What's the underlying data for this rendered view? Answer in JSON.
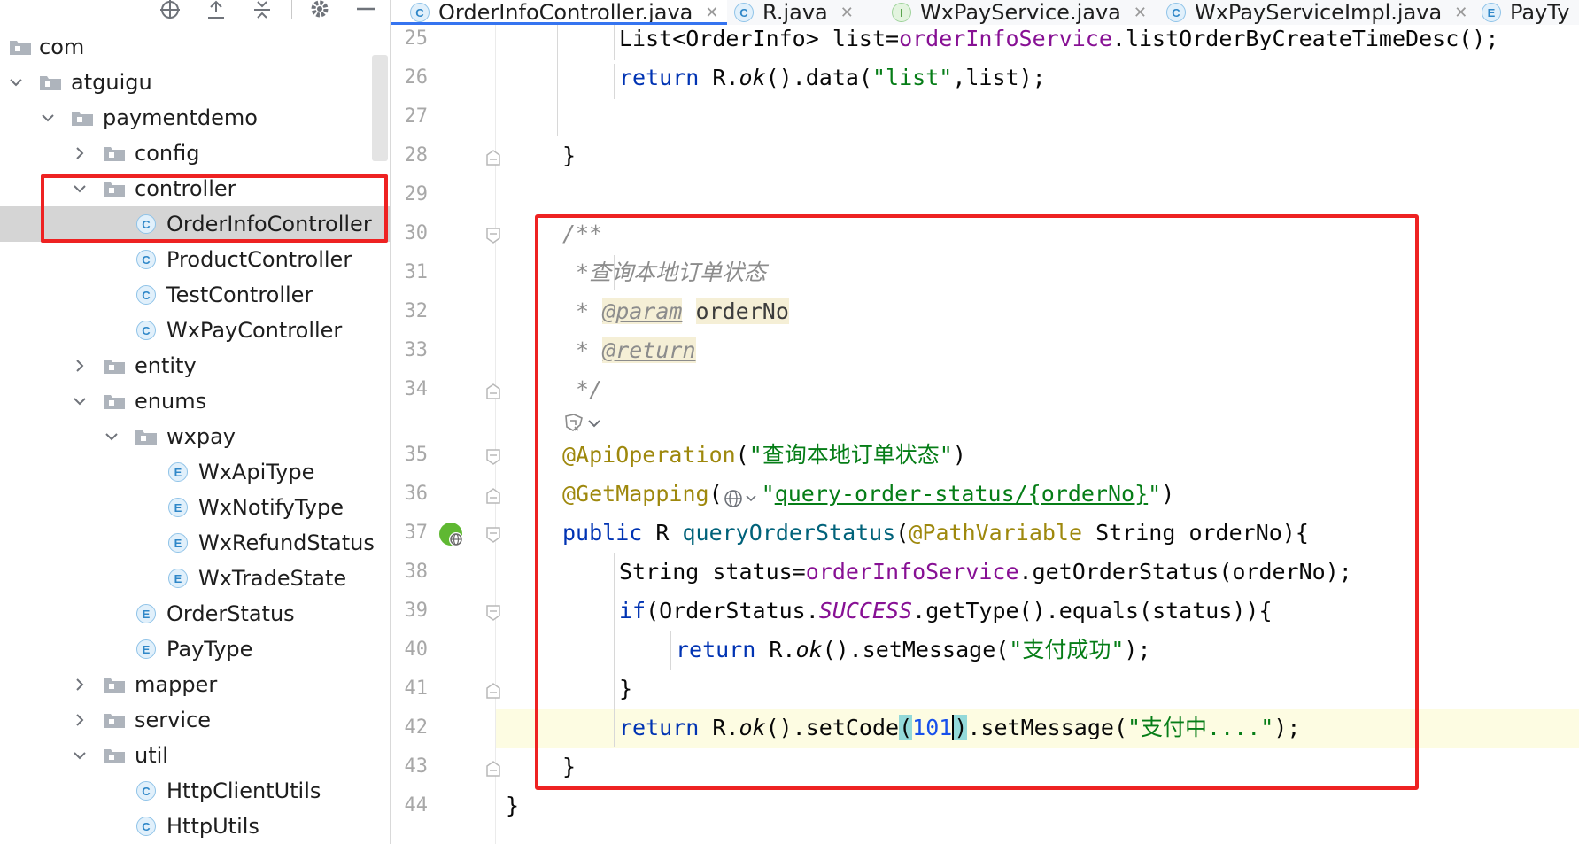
{
  "project_tree": {
    "items": [
      {
        "label": "com",
        "kind": "package",
        "expanded": null,
        "depth": 0
      },
      {
        "label": "atguigu",
        "kind": "package",
        "expanded": true,
        "depth": 0
      },
      {
        "label": "paymentdemo",
        "kind": "package",
        "expanded": true,
        "depth": 1
      },
      {
        "label": "config",
        "kind": "package",
        "expanded": false,
        "depth": 2
      },
      {
        "label": "controller",
        "kind": "package",
        "expanded": true,
        "depth": 2
      },
      {
        "label": "OrderInfoController",
        "kind": "class",
        "badge": "C",
        "depth": 3,
        "selected": true
      },
      {
        "label": "ProductController",
        "kind": "class",
        "badge": "C",
        "depth": 3
      },
      {
        "label": "TestController",
        "kind": "class",
        "badge": "C",
        "depth": 3
      },
      {
        "label": "WxPayController",
        "kind": "class",
        "badge": "C",
        "depth": 3
      },
      {
        "label": "entity",
        "kind": "package",
        "expanded": false,
        "depth": 2
      },
      {
        "label": "enums",
        "kind": "package",
        "expanded": true,
        "depth": 2
      },
      {
        "label": "wxpay",
        "kind": "package",
        "expanded": true,
        "depth": 3
      },
      {
        "label": "WxApiType",
        "kind": "enum",
        "badge": "E",
        "depth": 4
      },
      {
        "label": "WxNotifyType",
        "kind": "enum",
        "badge": "E",
        "depth": 4
      },
      {
        "label": "WxRefundStatus",
        "kind": "enum",
        "badge": "E",
        "depth": 4
      },
      {
        "label": "WxTradeState",
        "kind": "enum",
        "badge": "E",
        "depth": 4
      },
      {
        "label": "OrderStatus",
        "kind": "enum",
        "badge": "E",
        "depth": 3
      },
      {
        "label": "PayType",
        "kind": "enum",
        "badge": "E",
        "depth": 3
      },
      {
        "label": "mapper",
        "kind": "package",
        "expanded": false,
        "depth": 2
      },
      {
        "label": "service",
        "kind": "package",
        "expanded": false,
        "depth": 2
      },
      {
        "label": "util",
        "kind": "package",
        "expanded": true,
        "depth": 2
      },
      {
        "label": "HttpClientUtils",
        "kind": "class",
        "badge": "C",
        "depth": 3
      },
      {
        "label": "HttpUtils",
        "kind": "class",
        "badge": "C",
        "depth": 3
      }
    ]
  },
  "tabs": [
    {
      "label": "OrderInfoController.java",
      "badge": "C",
      "active": true
    },
    {
      "label": "R.java",
      "badge": "C",
      "active": false
    },
    {
      "label": "WxPayService.java",
      "badge": "I",
      "active": false
    },
    {
      "label": "WxPayServiceImpl.java",
      "badge": "C",
      "active": false
    },
    {
      "label": "PayTy",
      "badge": "E",
      "active": false
    }
  ],
  "editor": {
    "line_numbers": [
      "25",
      "26",
      "27",
      "28",
      "29",
      "30",
      "31",
      "32",
      "33",
      "34",
      "35",
      "36",
      "37",
      "38",
      "39",
      "40",
      "41",
      "42",
      "43",
      "44"
    ],
    "code": {
      "l25_a": "List<OrderInfo> list=",
      "l25_b": "orderInfoService",
      "l25_c": ".listOrderByCreateTimeDesc();",
      "l26_a": "return",
      "l26_b": " R.",
      "l26_c": "ok",
      "l26_d": "().data(",
      "l26_e": "\"list\"",
      "l26_f": ",list);",
      "l28": "}",
      "l30": "/**",
      "l31": " *查询本地订单状态",
      "l32_a": " * ",
      "l32_b": "@param",
      "l32_c": "orderNo",
      "l33_a": " * ",
      "l33_b": "@return",
      "l34": " */",
      "l35_a": "@ApiOperation",
      "l35_b": "(",
      "l35_c": "\"查询本地订单状态\"",
      "l35_d": ")",
      "l36_a": "@GetMapping",
      "l36_b": "(",
      "l36_c": "\"",
      "l36_d": "query-order-status/{orderNo}",
      "l36_e": "\"",
      "l36_f": ")",
      "l37_a": "public",
      "l37_b": " R ",
      "l37_c": "queryOrderStatus",
      "l37_d": "(",
      "l37_e": "@PathVariable",
      "l37_f": " String orderNo){",
      "l38_a": "String status=",
      "l38_b": "orderInfoService",
      "l38_c": ".getOrderStatus(orderNo);",
      "l39_a": "if",
      "l39_b": "(OrderStatus.",
      "l39_c": "SUCCESS",
      "l39_d": ".getType().equals(status)){",
      "l40_a": "return",
      "l40_b": " R.",
      "l40_c": "ok",
      "l40_d": "().setMessage(",
      "l40_e": "\"支付成功\"",
      "l40_f": ");",
      "l41": "}",
      "l42_a": "return",
      "l42_b": " R.",
      "l42_c": "ok",
      "l42_d": "().setCode",
      "l42_e": "(",
      "l42_f": "101",
      "l42_g": ")",
      "l42_h": ".setMessage(",
      "l42_i": "\"支付中....\"",
      "l42_j": ");",
      "l43": "}",
      "l44": "}"
    }
  },
  "colors": {
    "keyword": "#0033b3",
    "field": "#871094",
    "string": "#067d17",
    "annotation": "#9e880d",
    "comment": "#8c8c8c",
    "highlight_box": "#ee2222",
    "active_tab_underline": "#3574f0"
  },
  "icons": [
    "target-icon",
    "expand-all-icon",
    "collapse-all-icon",
    "gear-icon",
    "minimize-icon",
    "folder-icon",
    "chevron-right-icon",
    "chevron-down-icon",
    "class-icon",
    "enum-icon",
    "interface-icon",
    "close-icon",
    "web-endpoint-icon",
    "globe-icon",
    "ai-assistant-icon"
  ]
}
